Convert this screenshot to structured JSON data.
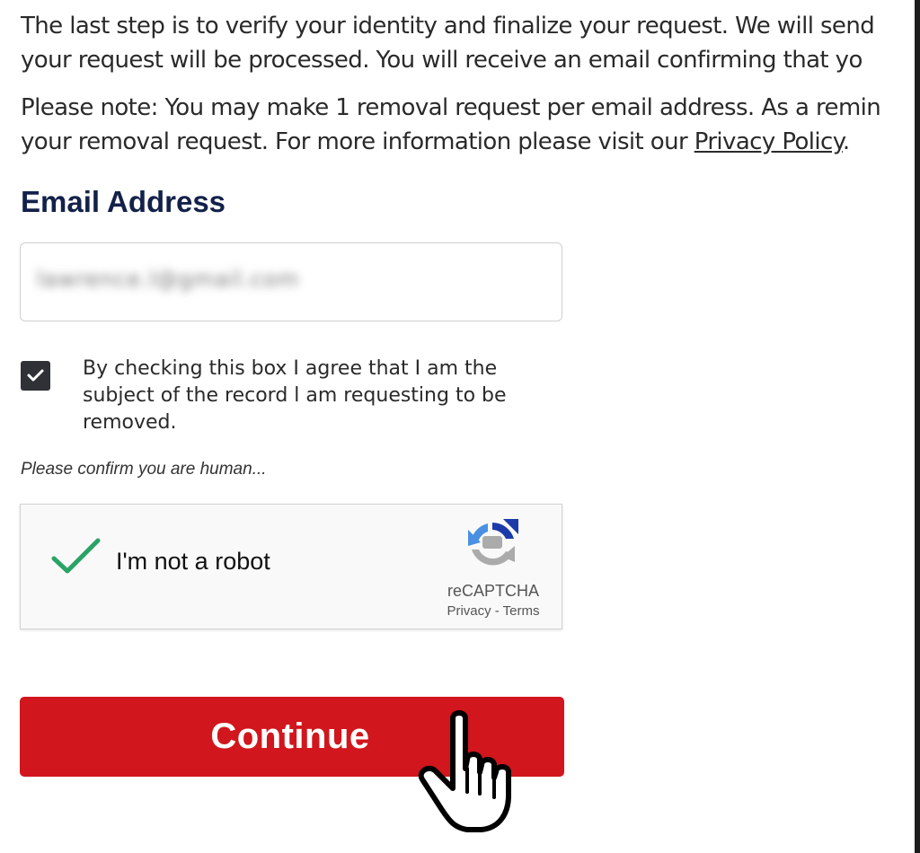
{
  "intro": {
    "line1": "The last step is to verify your identity and finalize your request. We will send",
    "line2": "your request will be processed. You will receive an email confirming that yo",
    "note_line1": "Please note: You may make 1 removal request per email address. As a remin",
    "note_line2_prefix": "your removal request. For more information please visit our ",
    "privacy_link": "Privacy Policy",
    "note_line2_suffix": "."
  },
  "form": {
    "email_label": "Email Address",
    "email_value": "lawrence.l@gmail.com",
    "consent_checked": true,
    "consent_text": "By checking this box I agree that I am the subject of the record l am requesting to be removed.",
    "human_prompt": "Please confirm you are human..."
  },
  "recaptcha": {
    "label": "I'm not a robot",
    "brand": "reCAPTCHA",
    "links": "Privacy - Terms",
    "verified": true
  },
  "actions": {
    "continue_label": "Continue"
  },
  "colors": {
    "heading": "#13214a",
    "primary_button": "#d1161d",
    "checkbox": "#2f3136",
    "recaptcha_check": "#2aa366"
  }
}
